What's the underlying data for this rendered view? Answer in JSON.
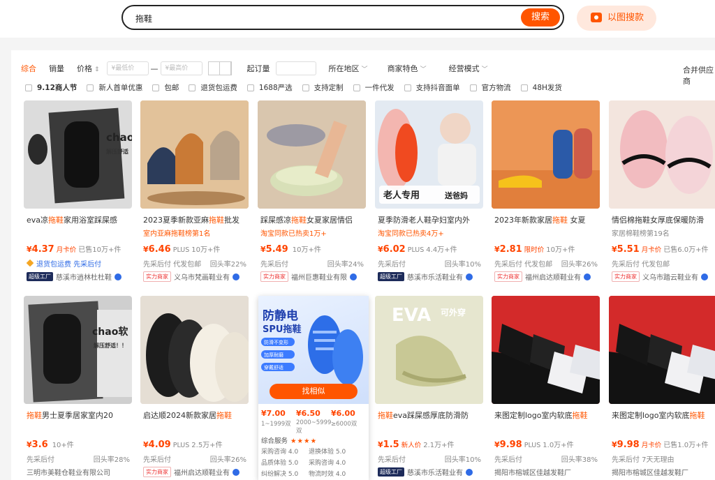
{
  "search": {
    "query": "拖鞋",
    "button": "搜索",
    "image_search": "以图搜款"
  },
  "filters": {
    "sort": [
      "综合",
      "销量",
      "价格"
    ],
    "price_min_placeholder": "¥最低价",
    "price_max_placeholder": "¥最高价",
    "dash": "—",
    "moq": "起订量",
    "location": "所在地区",
    "merchant": "商家特色",
    "mode": "经营模式",
    "merge": "合并供应商"
  },
  "chips": [
    "9.12商人节",
    "新人首单优惠",
    "包邮",
    "退货包运费",
    "1688严选",
    "支持定制",
    "一件代发",
    "支持抖音面单",
    "官方物流",
    "48H发货"
  ],
  "products": [
    {
      "title_pre": "eva凉",
      "hl": "拖鞋",
      "title_post": "家用浴室踩屎感",
      "sub": "",
      "price": "4.37",
      "ptag": "月卡价",
      "sold": "已售10万+件",
      "tags": "退货包运费  先采后付",
      "right": "",
      "badge": "超级工厂",
      "shop": "慈溪市逍林杜杜鞋"
    },
    {
      "title_pre": "2023夏季新款亚麻",
      "hl": "拖鞋",
      "title_post": "批发",
      "sub": "室内亚麻拖鞋榜第1名",
      "price": "6.46",
      "ptag": "PLUS",
      "sold": "10万+件",
      "tags": "先采后付  代发包邮",
      "right": "回头率22%",
      "badge": "实力商家",
      "shop": "义乌市梵画鞋业有"
    },
    {
      "title_pre": "踩屎感凉",
      "hl": "拖鞋",
      "title_post": "女夏家居情侣",
      "sub": "淘宝同款已热卖1万+",
      "price": "5.49",
      "ptag": "",
      "sold": "10万+件",
      "tags": "先采后付",
      "right": "回头率24%",
      "badge": "实力商家",
      "shop": "福州巨惠鞋业有限"
    },
    {
      "title_pre": "夏季防滑老人鞋孕妇室内外",
      "hl": "",
      "title_post": "",
      "sub": "淘宝同款已热卖4万+",
      "price": "6.02",
      "ptag": "PLUS",
      "sold": "4.4万+件",
      "tags": "先采后付",
      "right": "回头率10%",
      "badge": "超级工厂",
      "shop": "慈溪市乐活鞋业有"
    },
    {
      "title_pre": "2023年新款家居",
      "hl": "拖鞋",
      "title_post": " 女夏",
      "sub": "",
      "price": "2.81",
      "ptag": "限时价",
      "sold": "10万+件",
      "tags": "先采后付  代发包邮",
      "right": "回头率26%",
      "badge": "实力商家",
      "shop": "福州启达顺鞋业有"
    },
    {
      "title_pre": "情侣棉拖鞋女厚底保暖防滑",
      "hl": "",
      "title_post": "",
      "sub": "家居棉鞋榜第19名",
      "price": "5.51",
      "ptag": "月卡价",
      "sold": "已售6.0万+件",
      "tags": "先采后付  代发包邮",
      "right": "",
      "badge": "实力商家",
      "shop": "义乌市踏云鞋业有"
    },
    {
      "title_pre": "",
      "hl": "拖鞋",
      "title_post": "男士夏季居家室内20",
      "sub": "",
      "price": "3.6",
      "ptag": "",
      "sold": "10+件",
      "tags": "先采后付",
      "right": "回头率28%",
      "badge": "",
      "shop": "三明市美鞋仓鞋业有限公司"
    },
    {
      "title_pre": "启达顺2024新款家居",
      "hl": "拖鞋",
      "title_post": "",
      "sub": "",
      "price": "4.09",
      "ptag": "PLUS",
      "sold": "2.5万+件",
      "tags": "先采后付",
      "right": "回头率26%",
      "badge": "实力商家",
      "shop": "福州启达顺鞋业有"
    },
    {
      "title_pre": "",
      "hl": "拖鞋",
      "title_post": "eva踩屎感厚底防滑防",
      "sub": "",
      "price": "1.5",
      "ptag": "新人价",
      "sold": "2.1万+件",
      "tags": "先采后付",
      "right": "回头率10%",
      "badge": "超级工厂",
      "shop": "慈溪市乐活鞋业有"
    },
    {
      "title_pre": "来图定制logo室内软底",
      "hl": "拖鞋",
      "title_post": "",
      "sub": "",
      "price": "9.98",
      "ptag": "PLUS",
      "sold": "1.0万+件",
      "tags": "先采后付",
      "right": "回头率38%",
      "badge": "",
      "shop": "揭阳市榕城区佳越发鞋厂"
    },
    {
      "title_pre": "来图定制logo室内软底",
      "hl": "拖鞋",
      "title_post": "",
      "sub": "",
      "price": "9.98",
      "ptag": "月卡价",
      "sold": "已售1.0万+件",
      "tags": "先采后付  7天无理由",
      "right": "",
      "badge": "",
      "shop": "揭阳市榕城区佳越发鞋厂"
    }
  ],
  "hover": {
    "banner_top": "防静电",
    "banner_mid": "SPU拖鞋",
    "pill1": "防滑不变形",
    "pill2": "加厚耐磨",
    "pill3": "穿戴舒适",
    "find_similar": "找相似",
    "tiers": [
      {
        "price": "¥7.00",
        "range": "1~1999双"
      },
      {
        "price": "¥6.50",
        "range": "2000~5999双"
      },
      {
        "price": "¥6.00",
        "range": "≥6000双"
      }
    ],
    "service_label": "综合服务",
    "stars": "★★★★",
    "svc": [
      "采购咨询 4.0",
      "退换体验 5.0",
      "品质体验 5.0",
      "采购咨询 4.0",
      "纠纷解决 5.0",
      "物流时效 4.0"
    ]
  },
  "image_text": {
    "box1_brand": "chao",
    "box1_sub": "解压舒适",
    "box2_brand": "chao软",
    "box2_sub": "解压舒适！！",
    "elder": "老人专用",
    "dad": "送爸妈",
    "eva": "EVA",
    "eva_sub": "可外穿"
  }
}
